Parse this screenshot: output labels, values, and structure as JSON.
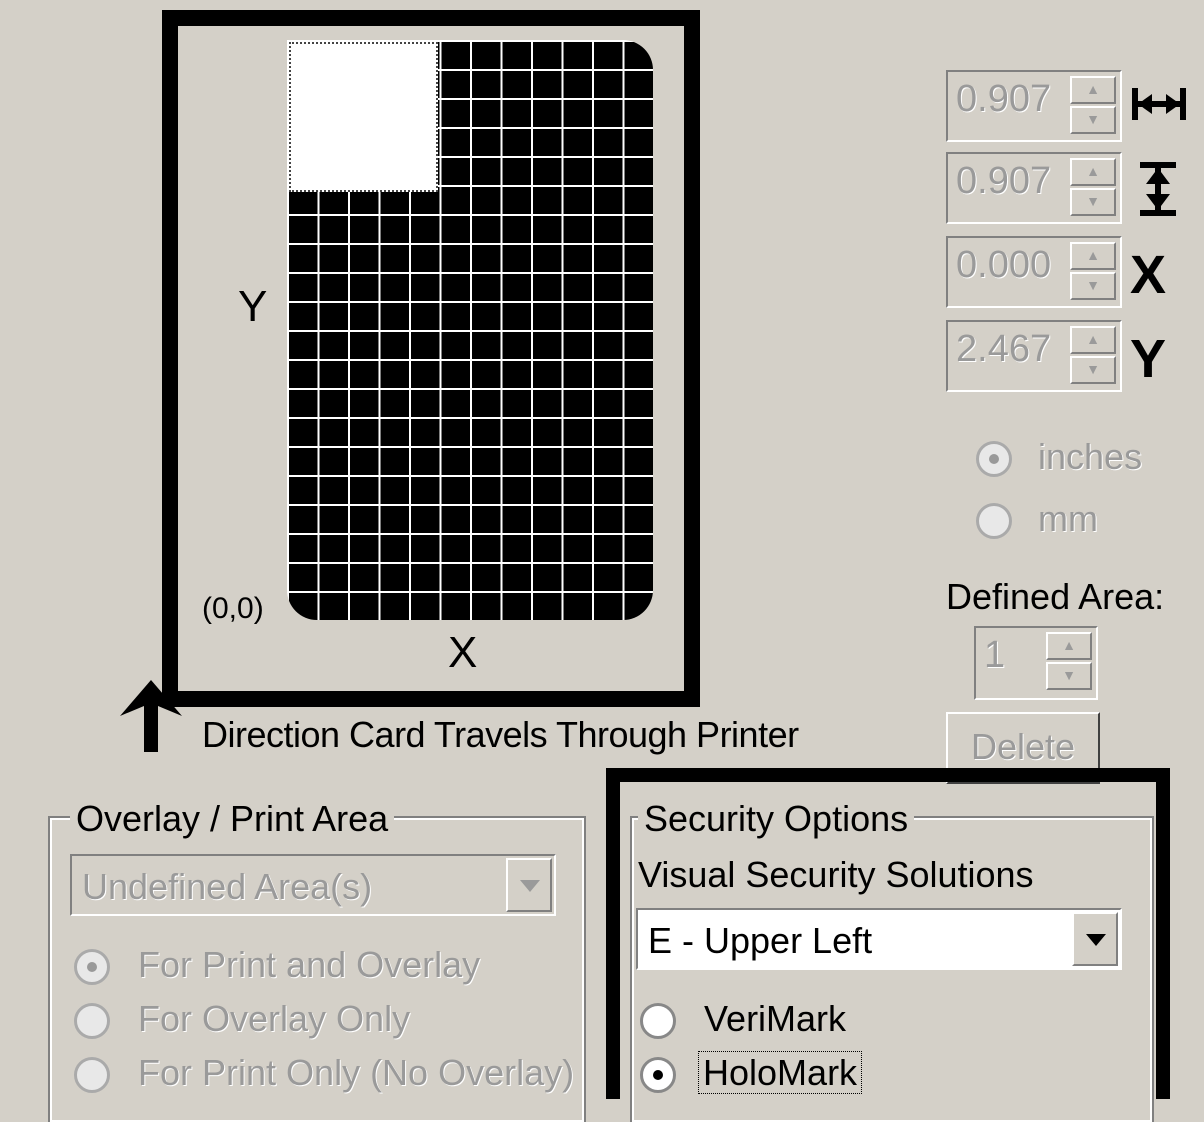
{
  "card": {
    "y_label": "Y",
    "x_label": "X",
    "origin_label": "(0,0)",
    "direction_text": "Direction Card Travels Through Printer"
  },
  "dimensions": [
    {
      "value": "0.907",
      "icon": "width-icon"
    },
    {
      "value": "0.907",
      "icon": "height-icon"
    },
    {
      "value": "0.000",
      "icon": "x-position-icon",
      "symbol": "X"
    },
    {
      "value": "2.467",
      "icon": "y-position-icon",
      "symbol": "Y"
    }
  ],
  "units": {
    "inches": "inches",
    "mm": "mm",
    "selected": "inches"
  },
  "defined_area": {
    "label": "Defined Area:",
    "value": "1",
    "delete_label": "Delete"
  },
  "overlay": {
    "title": "Overlay / Print Area",
    "combo_value": "Undefined Area(s)",
    "options": [
      "For Print and Overlay",
      "For Overlay Only",
      "For Print Only (No Overlay)"
    ],
    "selected_index": 0
  },
  "security": {
    "title": "Security Options",
    "subtitle": "Visual Security Solutions",
    "combo_value": "E - Upper Left",
    "options": [
      "VeriMark",
      "HoloMark"
    ],
    "selected_index": 1
  }
}
